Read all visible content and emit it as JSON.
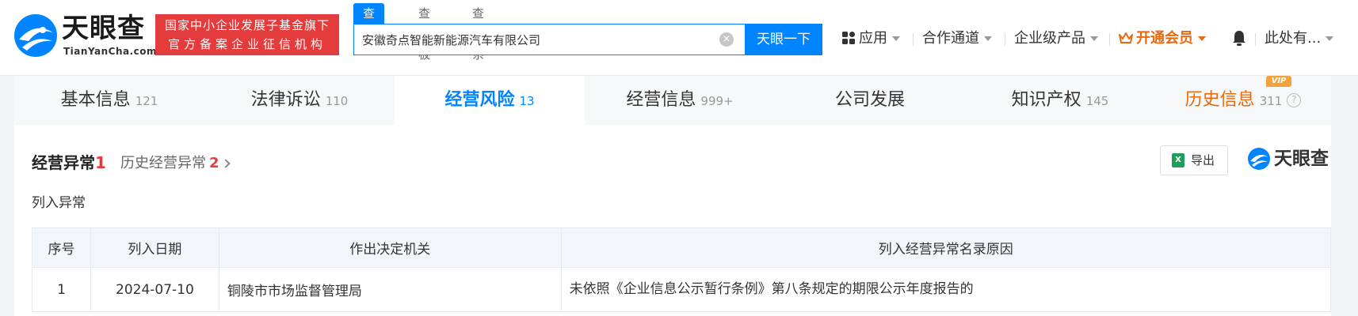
{
  "brand": {
    "name": "天眼查",
    "domain": "TianYanCha.com",
    "slogan_line1": "国家中小企业发展子基金旗下",
    "slogan_line2": "官方备案企业征信机构"
  },
  "search": {
    "tabs": [
      "查公司",
      "查老板",
      "查关系"
    ],
    "active_tab": 0,
    "query": "安徽奇点智能新能源汽车有限公司",
    "button_label": "天眼一下"
  },
  "nav": {
    "apps": "应用",
    "channel": "合作通道",
    "enterprise": "企业级产品",
    "vip": "开通会员",
    "user": "此处有..."
  },
  "tabs": [
    {
      "label": "基本信息",
      "count": "121"
    },
    {
      "label": "法律诉讼",
      "count": "110"
    },
    {
      "label": "经营风险",
      "count": "13"
    },
    {
      "label": "经营信息",
      "count": "999+"
    },
    {
      "label": "公司发展",
      "count": ""
    },
    {
      "label": "知识产权",
      "count": "145"
    },
    {
      "label": "历史信息",
      "count": "311"
    }
  ],
  "tab_vip_badge": "VIP",
  "section": {
    "title": "经营异常",
    "count": "1",
    "history_label": "历史经营异常",
    "history_count": "2",
    "export_label": "导出",
    "watermark": "天眼查",
    "sub_label": "列入异常"
  },
  "table": {
    "headers": [
      "序号",
      "列入日期",
      "作出决定机关",
      "列入经营异常名录原因"
    ],
    "rows": [
      [
        "1",
        "2024-07-10",
        "铜陵市市场监督管理局",
        "未依照《企业信息公示暂行条例》第八条规定的期限公示年度报告的"
      ]
    ]
  },
  "colors": {
    "primary": "#0084ff",
    "danger": "#e43c3c",
    "vip": "#e8690e"
  }
}
